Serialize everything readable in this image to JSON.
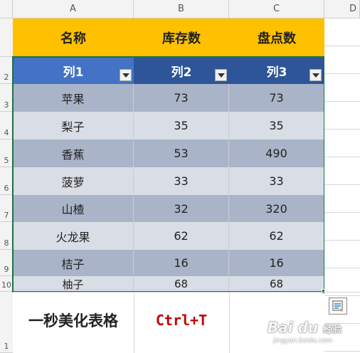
{
  "columns": [
    "A",
    "B",
    "C",
    "D"
  ],
  "row_numbers": [
    "",
    "2",
    "3",
    "4",
    "5",
    "6",
    "7",
    "8",
    "9",
    "10",
    "1"
  ],
  "header_row": [
    "名称",
    "库存数",
    "盘点数"
  ],
  "table_header": [
    "列1",
    "列2",
    "列3"
  ],
  "rows": [
    [
      "苹果",
      "73",
      "73"
    ],
    [
      "梨子",
      "35",
      "35"
    ],
    [
      "香蕉",
      "53",
      "490"
    ],
    [
      "菠萝",
      "33",
      "33"
    ],
    [
      "山楂",
      "32",
      "320"
    ],
    [
      "火龙果",
      "62",
      "62"
    ],
    [
      "桔子",
      "16",
      "16"
    ],
    [
      "柚子",
      "68",
      "68"
    ]
  ],
  "caption": "一秒美化表格",
  "shortcut": "Ctrl+T",
  "watermark": {
    "logo": "Bai du",
    "sub": "经验",
    "url": "jingyan.baidu.com"
  },
  "colors": {
    "header_fill": "#ffc000",
    "table_header_fill": "#2e5597",
    "band_dark": "#a9b4c8",
    "band_light": "#d9dde5",
    "shortcut_text": "#c00000",
    "selection_border": "#1e7145"
  },
  "icons": [
    "dropdown-arrow-icon",
    "quick-analysis-icon"
  ]
}
